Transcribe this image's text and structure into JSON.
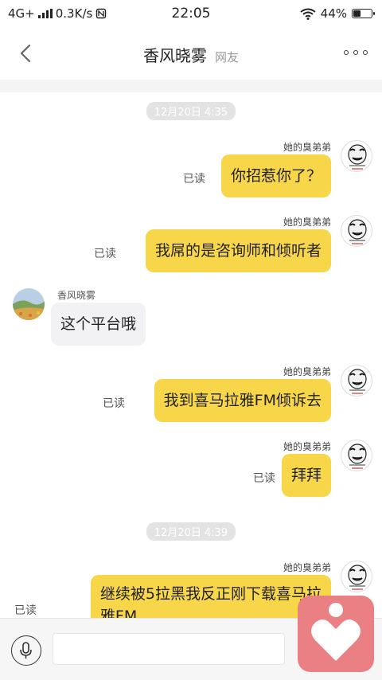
{
  "status_bar": {
    "network": "4G+",
    "speed": "0.3K/s",
    "time": "22:05",
    "battery": "44%",
    "battery_level": 0.44,
    "icons": [
      "signal-bars-icon",
      "nfc-icon",
      "wifi-icon",
      "battery-icon"
    ]
  },
  "nav": {
    "title": "香风晓雾",
    "subtitle": "网友",
    "back_icon": "chevron-left-icon",
    "more_icon": "more-dots-icon"
  },
  "messages": {
    "ts1": "12月20日 4:35",
    "m1": {
      "sender": "她的臭弟弟",
      "text": "你招惹你了？",
      "read": "已读"
    },
    "m2": {
      "sender": "她的臭弟弟",
      "text": "我屌的是咨询师和倾听者",
      "read": "已读"
    },
    "m3": {
      "sender": "香风晓雾",
      "text": "这个平台哦"
    },
    "m4": {
      "sender": "她的臭弟弟",
      "text": "我到喜马拉雅FM倾诉去",
      "read": "已读"
    },
    "m5": {
      "sender": "她的臭弟弟",
      "text": "拜拜",
      "read": "已读"
    },
    "ts2": "12月20日 4:39",
    "m6": {
      "sender": "她的臭弟弟",
      "text_line1": "继续被5拉黑我反正刚下载喜马拉",
      "text_line2": "雅FM",
      "read": "已读"
    }
  },
  "input": {
    "mic_icon": "microphone-icon",
    "placeholder": "",
    "value": ""
  },
  "floating_button": {
    "icon": "heart-person-icon",
    "color": "#ea7f84"
  },
  "colors": {
    "outgoing_bubble": "#f7d64a",
    "incoming_bubble": "#f2f2f4"
  }
}
